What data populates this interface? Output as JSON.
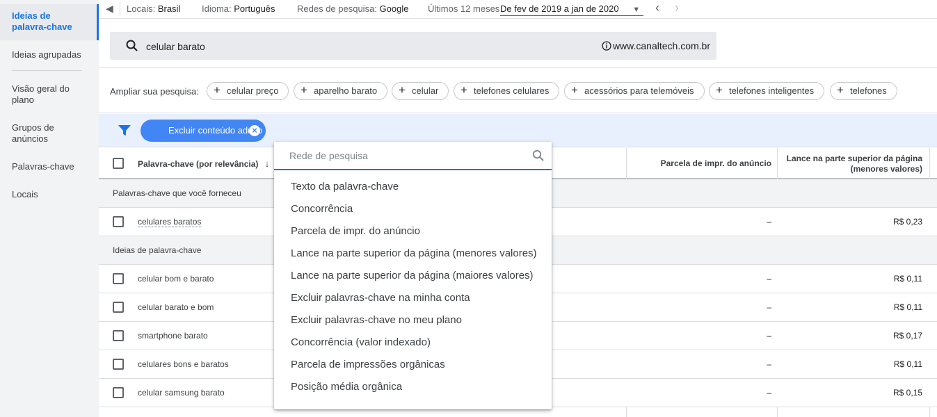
{
  "sidebar": {
    "items": [
      {
        "label": "Ideias de palavra-chave",
        "active": true
      },
      {
        "label": "Ideias agrupadas"
      },
      {
        "label": "Visão geral do plano"
      },
      {
        "label": "Grupos de anúncios"
      },
      {
        "label": "Palavras-chave"
      },
      {
        "label": "Locais"
      }
    ]
  },
  "topbar": {
    "locations_label": "Locais:",
    "locations_value": "Brasil",
    "language_label": "Idioma:",
    "language_value": "Português",
    "network_label": "Redes de pesquisa:",
    "network_value": "Google",
    "period_label": "Últimos 12 meses",
    "period_value": "De fev de 2019 a jan de 2020"
  },
  "search": {
    "query": "celular barato",
    "site": "www.canaltech.com.br"
  },
  "widen": {
    "label": "Ampliar sua pesquisa:",
    "chips": [
      "celular preço",
      "aparelho barato",
      "celular",
      "telefones celulares",
      "acessórios para telemóveis",
      "telefones inteligentes",
      "telefones"
    ]
  },
  "filter": {
    "chip_label": "Excluir conteúdo adulto"
  },
  "table": {
    "headers": {
      "keyword": "Palavra-chave (por relevância)",
      "impr_share": "Parcela de impr. do anúncio",
      "top_bid_low_1": "Lance na parte superior da página",
      "top_bid_low_2": "(menores valores)"
    },
    "group_provided": "Palavras-chave que você forneceu",
    "group_ideas": "Ideias de palavra-chave",
    "provided_rows": [
      {
        "keyword": "celulares baratos",
        "impr_share": "–",
        "top_bid_low": "R$ 0,23"
      }
    ],
    "idea_rows": [
      {
        "keyword": "celular bom e barato",
        "impr_share": "–",
        "top_bid_low": "R$ 0,11"
      },
      {
        "keyword": "celular barato e bom",
        "impr_share": "–",
        "top_bid_low": "R$ 0,11"
      },
      {
        "keyword": "smartphone barato",
        "impr_share": "–",
        "top_bid_low": "R$ 0,17"
      },
      {
        "keyword": "celulares bons e baratos",
        "impr_share": "–",
        "top_bid_low": "R$ 0,11"
      },
      {
        "keyword": "celular samsung barato",
        "impr_share": "–",
        "top_bid_low": "R$ 0,15"
      }
    ]
  },
  "dropdown": {
    "search_placeholder": "Rede de pesquisa",
    "items": [
      "Texto da palavra-chave",
      "Concorrência",
      "Parcela de impr. do anúncio",
      "Lance na parte superior da página (menores valores)",
      "Lance na parte superior da página (maiores valores)",
      "Excluir palavras-chave na minha conta",
      "Excluir palavras-chave no meu plano",
      "Concorrência (valor indexado)",
      "Parcela de impressões orgânicas",
      "Posição média orgânica"
    ]
  },
  "colors": {
    "accent": "#1a73e8",
    "chip_blue": "#4285f4",
    "filter_band": "#e8f0fe"
  }
}
